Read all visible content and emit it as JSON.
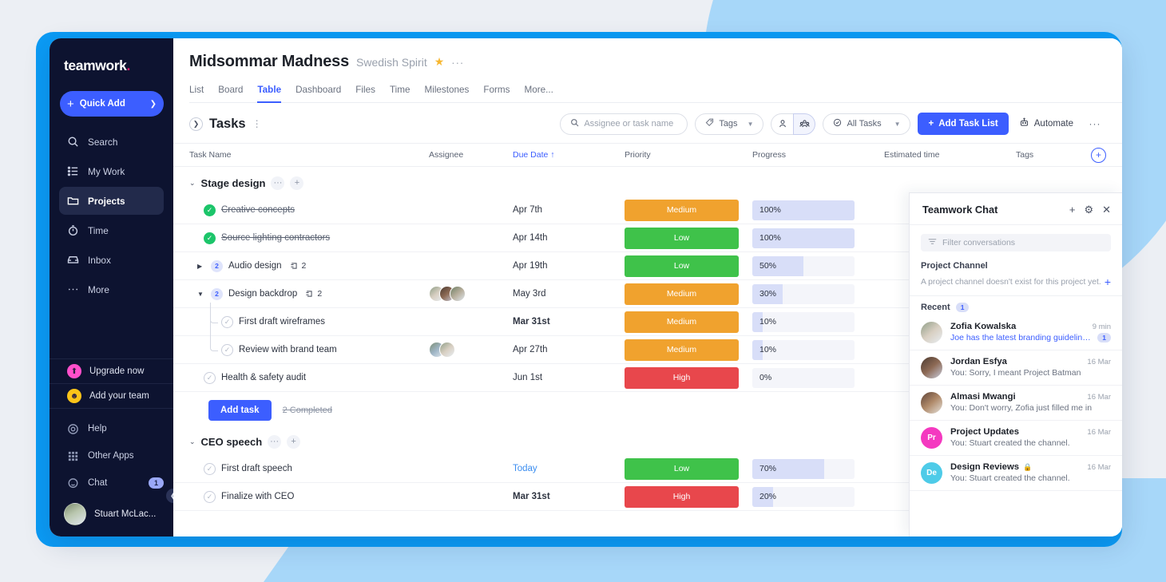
{
  "sidebar": {
    "logo": "teamwork",
    "logo_dot": ".",
    "quick_add": "Quick Add",
    "nav": [
      {
        "label": "Search",
        "icon": "search-icon"
      },
      {
        "label": "My Work",
        "icon": "list-icon"
      },
      {
        "label": "Projects",
        "icon": "folder-icon"
      },
      {
        "label": "Time",
        "icon": "clock-icon"
      },
      {
        "label": "Inbox",
        "icon": "inbox-icon"
      },
      {
        "label": "More",
        "icon": "ellipsis-icon"
      }
    ],
    "promos": [
      {
        "label": "Upgrade now",
        "icon": "upgrade-arrow-icon"
      },
      {
        "label": "Add your team",
        "icon": "add-person-icon"
      }
    ],
    "footer": [
      {
        "label": "Help",
        "icon": "lifebuoy-icon"
      },
      {
        "label": "Other Apps",
        "icon": "grid-apps-icon"
      },
      {
        "label": "Chat",
        "icon": "chat-bubble-icon",
        "badge": "1"
      }
    ],
    "user": "Stuart McLac..."
  },
  "header": {
    "title": "Midsommar Madness",
    "subtitle": "Swedish Spirit",
    "star": "★",
    "more_dots": "···",
    "tabs": [
      {
        "label": "List"
      },
      {
        "label": "Board"
      },
      {
        "label": "Table"
      },
      {
        "label": "Dashboard"
      },
      {
        "label": "Files"
      },
      {
        "label": "Time"
      },
      {
        "label": "Milestones"
      },
      {
        "label": "Forms"
      },
      {
        "label": "More..."
      }
    ],
    "active_tab": "Table"
  },
  "toolbar": {
    "tasks_label": "Tasks",
    "search_placeholder": "Assignee or task name",
    "tags_label": "Tags",
    "all_tasks_label": "All Tasks",
    "add_task_list_label": "Add Task List",
    "automate_label": "Automate",
    "dots_label": "···"
  },
  "table": {
    "columns": [
      "Task Name",
      "Assignee",
      "Due Date ↑",
      "Priority",
      "Progress",
      "Estimated time",
      "Tags"
    ],
    "groups": [
      {
        "name": "Stage design",
        "add_task_label": "Add task",
        "completed_label": "2 Completed",
        "rows": [
          {
            "name": "Creative concepts",
            "done": true,
            "due": "Apr 7th",
            "priority": "Medium",
            "progress": "100%",
            "progress_value": 100,
            "estimated": "",
            "tags": ""
          },
          {
            "name": "Source lighting contractors",
            "done": true,
            "due": "Apr 14th",
            "priority": "Low",
            "progress": "100%",
            "progress_value": 100,
            "estimated": "",
            "tags": ""
          },
          {
            "name": "Audio design",
            "done": false,
            "subcount": "2",
            "dependency": "2",
            "due": "Apr 19th",
            "priority": "Low",
            "progress": "50%",
            "progress_value": 50,
            "estimated": "",
            "tags": ""
          },
          {
            "name": "Design backdrop",
            "done": false,
            "subcount": "2",
            "dependency": "2",
            "due": "May 3rd",
            "priority": "Medium",
            "progress": "30%",
            "progress_value": 30,
            "estimated": "",
            "tags": ""
          },
          {
            "name": "First draft wireframes",
            "done": false,
            "due": "Mar 31st",
            "priority": "Medium",
            "progress": "10%",
            "progress_value": 10,
            "estimated": "",
            "tags": ""
          },
          {
            "name": "Review with brand team",
            "done": false,
            "due": "Apr 27th",
            "priority": "Medium",
            "progress": "10%",
            "progress_value": 10,
            "estimated": "",
            "tags": ""
          },
          {
            "name": "Health & safety audit",
            "done": false,
            "due": "Jun 1st",
            "priority": "High",
            "progress": "0%",
            "progress_value": 0,
            "estimated": "",
            "tags": ""
          }
        ]
      },
      {
        "name": "CEO speech",
        "rows": [
          {
            "name": "First draft speech",
            "done": false,
            "due": "Today",
            "priority": "Low",
            "progress": "70%",
            "progress_value": 70,
            "estimated": "",
            "tags": ""
          },
          {
            "name": "Finalize with CEO",
            "done": false,
            "due": "Mar 31st",
            "priority": "High",
            "progress": "20%",
            "progress_value": 20,
            "estimated": "",
            "tags": ""
          }
        ]
      }
    ]
  },
  "chat": {
    "title": "Teamwork Chat",
    "filter_placeholder": "Filter conversations",
    "project_channel_title": "Project Channel",
    "project_channel_empty": "A project channel doesn't exist for this project yet.",
    "recent_title": "Recent",
    "recent_count": "1",
    "conversations": [
      {
        "name": "Zofia Kowalska",
        "time": "9 min",
        "message": "Joe has the latest branding guidelines...",
        "unread": "1",
        "avatar_type": "photo",
        "locked": false
      },
      {
        "name": "Jordan Esfya",
        "time": "16 Mar",
        "message": "You: Sorry, I meant Project Batman",
        "unread": "",
        "avatar_type": "photo",
        "locked": false
      },
      {
        "name": "Almasi Mwangi",
        "time": "16 Mar",
        "message": "You: Don't worry, Zofia just filled me in",
        "unread": "",
        "avatar_type": "photo",
        "locked": false
      },
      {
        "name": "Project Updates",
        "time": "16 Mar",
        "message": "You: Stuart created the channel.",
        "unread": "",
        "avatar_type": "initials",
        "initials": "Pr",
        "locked": false
      },
      {
        "name": "Design Reviews",
        "time": "16 Mar",
        "message": "You: Stuart created the channel.",
        "unread": "",
        "avatar_type": "initials",
        "initials": "De",
        "locked": true
      }
    ]
  },
  "colors": {
    "accent": "#3c5eff",
    "frame_blue": "#0b9bf5",
    "deco_blue": "#a7d7f9",
    "priority_low": "#3fc24a",
    "priority_medium": "#f0a22e",
    "priority_high": "#e8474c",
    "done_green": "#1cc56a",
    "progress_fill": "#d8def8"
  }
}
